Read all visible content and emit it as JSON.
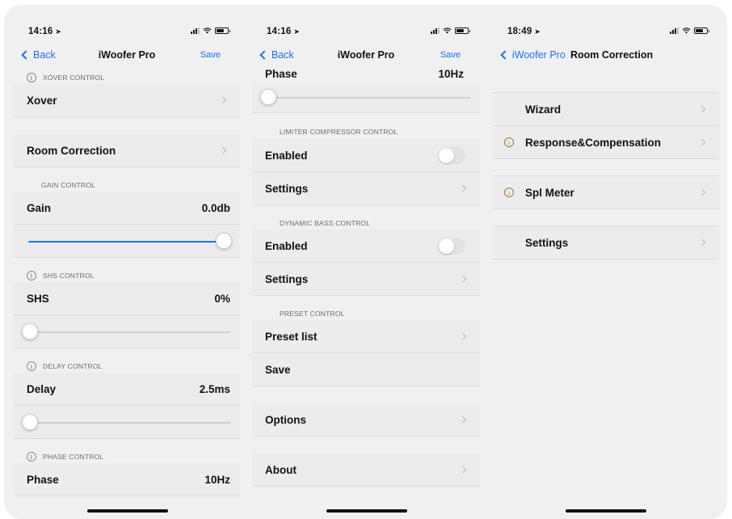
{
  "left": {
    "time": "14:16",
    "nav": {
      "back": "Back",
      "title": "iWoofer Pro",
      "action": "Save"
    },
    "sections": {
      "xover_header": "XOVER CONTROL",
      "xover": "Xover",
      "room": "Room Correction",
      "gain_header": "GAIN CONTROL",
      "gain": {
        "label": "Gain",
        "value": "0.0db",
        "level": 1.0
      },
      "shs_header": "SHS CONTROL",
      "shs": {
        "label": "SHS",
        "value": "0%",
        "level": 0.0
      },
      "delay_header": "DELAY CONTROL",
      "delay": {
        "label": "Delay",
        "value": "2.5ms",
        "level": 0.0
      },
      "phase_header": "PHASE CONTROL",
      "phase": {
        "label": "Phase",
        "value": "10Hz"
      }
    }
  },
  "middle": {
    "time": "14:16",
    "nav": {
      "back": "Back",
      "title": "iWoofer Pro",
      "action": "Save"
    },
    "phase": {
      "label": "Phase",
      "value": "10Hz",
      "level": 0.0
    },
    "limiter_header": "LIMITER COMPRESSOR CONTROL",
    "limiter_enabled": "Enabled",
    "limiter_settings": "Settings",
    "bass_header": "DYNAMIC BASS CONTROL",
    "bass_enabled": "Enabled",
    "bass_settings": "Settings",
    "preset_header": "PRESET CONTROL",
    "preset_list": "Preset list",
    "save": "Save",
    "options": "Options",
    "about": "About"
  },
  "right": {
    "time": "18:49",
    "nav": {
      "back": "iWoofer Pro",
      "title": "Room Correction"
    },
    "wizard": "Wizard",
    "response": "Response&Compensation",
    "spl": "Spl Meter",
    "settings": "Settings"
  },
  "colors": {
    "accent": "#1a73e8",
    "background": "#f0f0f3",
    "info_amber": "#a07a2e"
  },
  "icons": [
    "location-arrow-icon",
    "signal-icon",
    "wifi-icon",
    "battery-icon",
    "chevron-left-icon",
    "chevron-right-icon",
    "info-icon"
  ]
}
